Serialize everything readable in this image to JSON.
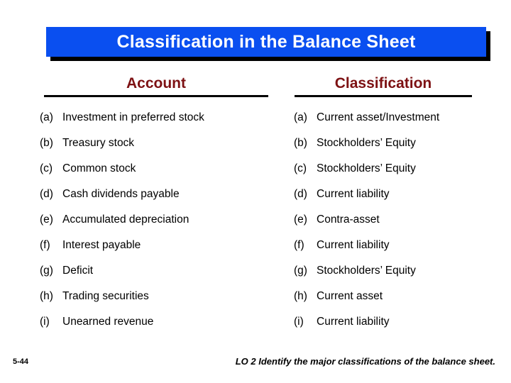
{
  "slide": {
    "title": "Classification in the Balance Sheet",
    "title_bg_color": "#0a4ff0",
    "title_text_color": "#ffffff",
    "header_color": "#7d1113",
    "background_color": "#ffffff"
  },
  "table": {
    "headers": {
      "account": "Account",
      "classification": "Classification"
    },
    "rows": [
      {
        "label": "(a)",
        "account": "Investment in preferred stock",
        "classification": "Current asset/Investment"
      },
      {
        "label": "(b)",
        "account": "Treasury stock",
        "classification": "Stockholders’ Equity"
      },
      {
        "label": "(c)",
        "account": "Common stock",
        "classification": "Stockholders’ Equity"
      },
      {
        "label": "(d)",
        "account": "Cash dividends payable",
        "classification": "Current liability"
      },
      {
        "label": "(e)",
        "account": "Accumulated depreciation",
        "classification": "Contra-asset"
      },
      {
        "label": "(f)",
        "account": "Interest payable",
        "classification": "Current liability"
      },
      {
        "label": "(g)",
        "account": "Deficit",
        "classification": "Stockholders’ Equity"
      },
      {
        "label": "(h)",
        "account": "Trading securities",
        "classification": "Current asset"
      },
      {
        "label": "(i)",
        "account": "Unearned revenue",
        "classification": "Current liability"
      }
    ]
  },
  "footer": {
    "slide_number": "5-44",
    "learning_objective": "LO 2  Identify the major classifications of the balance sheet."
  }
}
